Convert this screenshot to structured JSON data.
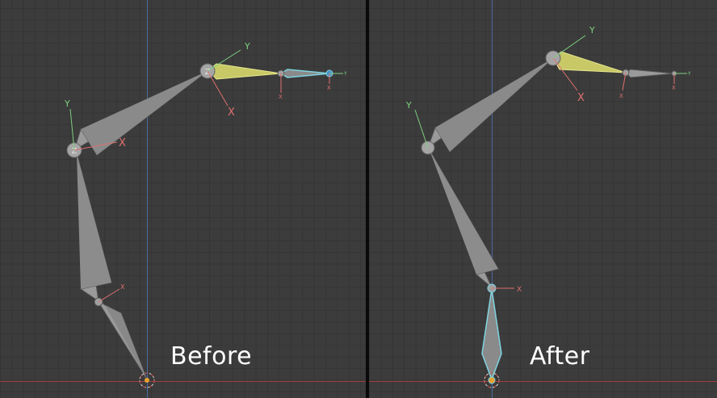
{
  "panels": [
    {
      "caption": "Before"
    },
    {
      "caption": "After"
    }
  ],
  "axis_labels": {
    "x": "X",
    "y": "Y",
    "z": "Z"
  },
  "colors": {
    "grid_bg": "#3c3c3c",
    "grid_line": "#353535",
    "bone": "#9a9a9a",
    "bone_selected_active": "#c8c866",
    "bone_selected": "#7fd4e0",
    "axis_x": "#e07070",
    "axis_y": "#7ed07e",
    "world_y_axis": "#4a6aa0",
    "world_x_axis": "#a04040"
  }
}
